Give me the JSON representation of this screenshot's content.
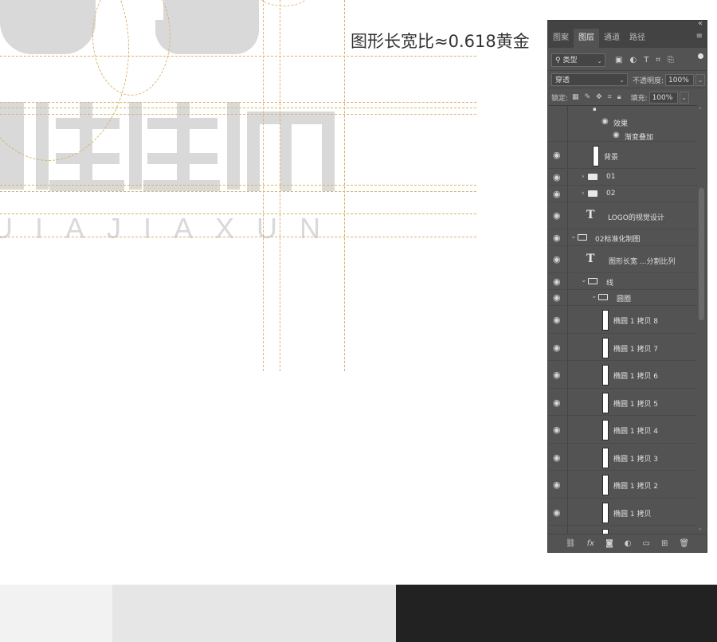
{
  "canvas": {
    "ratio_text": "图形长宽比≈0.618黄金",
    "pinyin": "UIAJIAXUN"
  },
  "colors": {
    "guide": "#d9b46a",
    "logo": "#d9d9d9",
    "panel_bg": "#535353",
    "swatch_1": "#f2f2f2",
    "swatch_2": "#e6e6e6",
    "swatch_3": "#232222"
  },
  "panel": {
    "tabs": [
      "图案",
      "图层",
      "通道",
      "路径"
    ],
    "active_tab": "图层",
    "kind_filter": "类型",
    "blend_mode": "穿透",
    "opacity_label": "不透明度:",
    "opacity_value": "100%",
    "lock_label": "锁定:",
    "fill_label": "填充:",
    "fill_value": "100%",
    "icons": {
      "collapse": "double-chevron-icon",
      "menu": "hamburger-icon",
      "search": "search-icon",
      "filter_image": "image-filter-icon",
      "filter_adjust": "adjustment-filter-icon",
      "filter_type": "type-filter-icon",
      "filter_shape": "shape-filter-icon",
      "filter_smart": "smart-object-filter-icon",
      "lock_pixels": "checkerboard-icon",
      "lock_brush": "brush-icon",
      "lock_move": "move-icon",
      "lock_artboard": "crop-icon",
      "lock_all": "lock-icon"
    },
    "layers": [
      {
        "name": "效果",
        "kind": "effect"
      },
      {
        "name": "渐变叠加",
        "kind": "effect-item"
      },
      {
        "name": "背景",
        "kind": "pixel"
      },
      {
        "name": "01",
        "kind": "group"
      },
      {
        "name": "02",
        "kind": "group"
      },
      {
        "name": "LOGO的视觉设计",
        "kind": "text"
      },
      {
        "name": "02标准化制图",
        "kind": "group-open"
      },
      {
        "name": "图形长宽 ...分割比列",
        "kind": "text"
      },
      {
        "name": "线",
        "kind": "group-open"
      },
      {
        "name": "圆圈",
        "kind": "group-open"
      },
      {
        "name": "椭圆 1 拷贝 8",
        "kind": "shape"
      },
      {
        "name": "椭圆 1 拷贝 7",
        "kind": "shape"
      },
      {
        "name": "椭圆 1 拷贝 6",
        "kind": "shape"
      },
      {
        "name": "椭圆 1 拷贝 5",
        "kind": "shape"
      },
      {
        "name": "椭圆 1 拷贝 4",
        "kind": "shape"
      },
      {
        "name": "椭圆 1 拷贝 3",
        "kind": "shape"
      },
      {
        "name": "椭圆 1 拷贝 2",
        "kind": "shape"
      },
      {
        "name": "椭圆 1 拷贝",
        "kind": "shape"
      }
    ],
    "bottom_icons": [
      "link-icon",
      "fx-icon",
      "mask-icon",
      "adjustment-layer-icon",
      "new-group-icon",
      "new-layer-icon",
      "trash-icon"
    ],
    "bottom_labels": {
      "fx": "fx"
    }
  }
}
